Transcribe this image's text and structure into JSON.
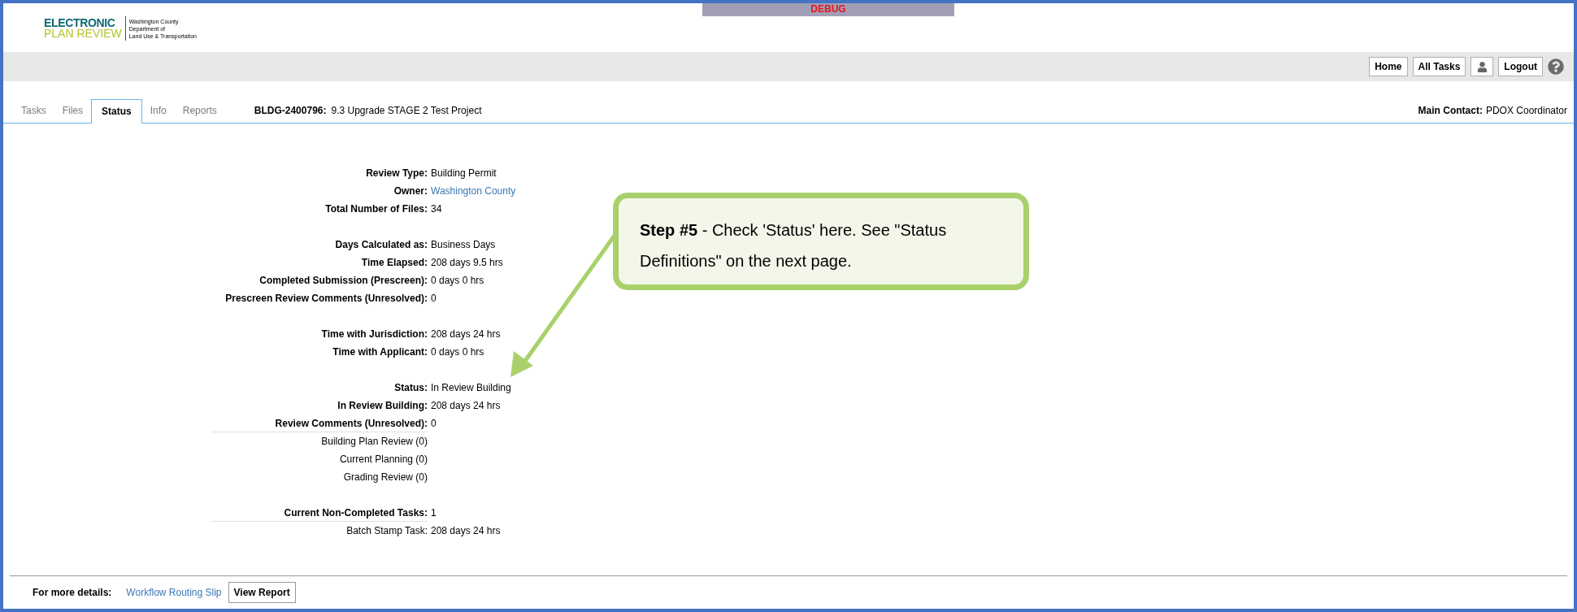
{
  "header": {
    "logo": {
      "line1": "ELECTRONIC",
      "line2": "PLAN REVIEW",
      "agency": [
        "Washington County",
        "Department of",
        "Land Use & Transportation"
      ]
    },
    "debug": "DEBUG"
  },
  "nav_buttons": [
    {
      "kind": "text",
      "label": "Home"
    },
    {
      "kind": "text",
      "label": "All Tasks"
    },
    {
      "kind": "user"
    },
    {
      "kind": "text",
      "label": "Logout"
    },
    {
      "kind": "help"
    }
  ],
  "tabs": [
    {
      "label": "Tasks",
      "selected": false
    },
    {
      "label": "Files",
      "selected": false
    },
    {
      "label": "Status",
      "selected": true
    },
    {
      "label": "Info",
      "selected": false
    },
    {
      "label": "Reports",
      "selected": false
    }
  ],
  "project": {
    "id": "BLDG-2400796:",
    "name": "9.3 Upgrade STAGE 2 Test Project"
  },
  "main_contact": {
    "label": "Main Contact:",
    "value": "PDOX Coordinator"
  },
  "sections": [
    [
      {
        "kind": "field",
        "label": "Review Type:",
        "value": "Building Permit",
        "divider": false
      },
      {
        "kind": "link",
        "label": "Owner:",
        "value": "Washington County",
        "divider": false
      },
      {
        "kind": "field",
        "label": "Total Number of Files:",
        "value": "34",
        "divider": false
      }
    ],
    [
      {
        "kind": "field",
        "label": "Days Calculated as:",
        "value": "Business Days",
        "divider": false
      },
      {
        "kind": "field",
        "label": "Time Elapsed:",
        "value": "208 days 9.5 hrs",
        "divider": false
      },
      {
        "kind": "field",
        "label": "Completed Submission (Prescreen):",
        "value": "0 days 0 hrs",
        "divider": false
      },
      {
        "kind": "field",
        "label": "Prescreen Review Comments (Unresolved):",
        "value": "0",
        "divider": false
      }
    ],
    [
      {
        "kind": "field",
        "label": "Time with Jurisdiction:",
        "value": "208 days 24 hrs",
        "divider": false
      },
      {
        "kind": "field",
        "label": "Time with Applicant:",
        "value": "0 days 0 hrs",
        "divider": false
      }
    ],
    [
      {
        "kind": "field",
        "label": "Status:",
        "value": "In Review Building",
        "divider": false
      },
      {
        "kind": "field",
        "label": "In Review Building:",
        "value": "208 days 24 hrs",
        "divider": false
      },
      {
        "kind": "field",
        "label": "Review Comments (Unresolved):",
        "value": "0",
        "divider": true
      },
      {
        "kind": "detail",
        "label": "Building Plan Review (0)",
        "divider": false
      },
      {
        "kind": "detail",
        "label": "Current Planning (0)",
        "divider": false
      },
      {
        "kind": "detail",
        "label": "Grading Review (0)",
        "divider": false
      }
    ],
    [
      {
        "kind": "field",
        "label": "Current Non-Completed Tasks:",
        "value": "1",
        "divider": true
      },
      {
        "kind": "detail",
        "label": "Batch Stamp Task:",
        "value": "208 days 24 hrs",
        "divider": false
      }
    ]
  ],
  "callout": {
    "text": "**Step #5** - Check 'Status' here. See \"Status Definitions\" on the next page."
  },
  "footer": {
    "label": "For more details:",
    "link": "Workflow Routing Slip",
    "button": "View Report"
  }
}
